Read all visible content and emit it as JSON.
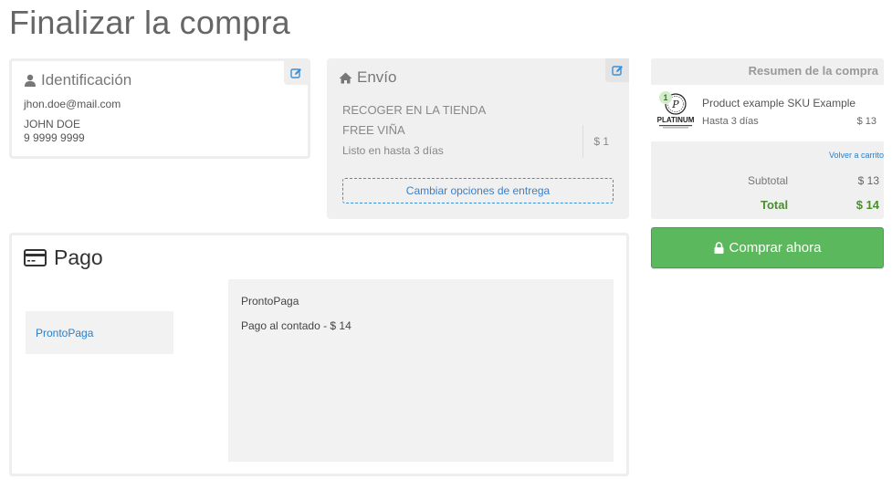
{
  "page": {
    "title": "Finalizar la compra"
  },
  "identification": {
    "title": "Identificación",
    "email": "jhon.doe@mail.com",
    "name": "JOHN DOE",
    "phone": "9 9999 9999"
  },
  "shipping": {
    "title": "Envío",
    "method": "RECOGER EN LA TIENDA",
    "store": "FREE VIÑA",
    "ready": "Listo en hasta 3 días",
    "price": "$ 1",
    "change_label": "Cambiar opciones de entrega"
  },
  "payment": {
    "title": "Pago",
    "tab_label": "ProntoPaga",
    "panel_name": "ProntoPaga",
    "panel_desc": "Pago al contado - $ 14"
  },
  "summary": {
    "header": "Resumen de la compra",
    "item": {
      "quantity": "1",
      "name": "Product example SKU Example",
      "delivery": "Hasta 3 días",
      "price": "$ 13",
      "logo_text": "PLATINUM"
    },
    "back_link": "Volver a carrito",
    "subtotal_label": "Subtotal",
    "subtotal_value": "$ 13",
    "total_label": "Total",
    "total_value": "$ 14"
  },
  "buy_button": {
    "label": "Comprar ahora"
  },
  "colors": {
    "accent_blue": "#2a7ec6",
    "success_green": "#5cb85c",
    "total_green": "#4a8f2e"
  },
  "icons": [
    "user-icon",
    "edit-icon",
    "home-icon",
    "credit-card-icon",
    "lock-icon"
  ]
}
